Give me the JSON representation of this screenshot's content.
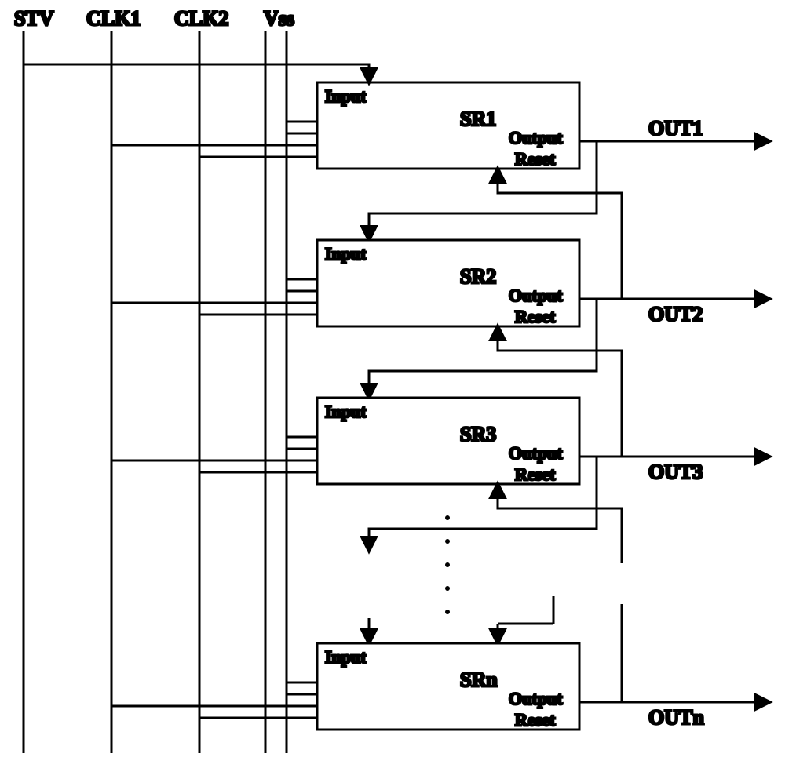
{
  "signals": {
    "stv": "STV",
    "clk1": "CLK1",
    "clk2": "CLK2",
    "vss": "Vss"
  },
  "port_labels": {
    "input": "Input",
    "output": "Output",
    "reset": "Reset"
  },
  "blocks": {
    "sr1": "SR1",
    "sr2": "SR2",
    "sr3": "SR3",
    "srn": "SRn"
  },
  "outputs": {
    "out1": "OUT1",
    "out2": "OUT2",
    "out3": "OUT3",
    "outn": "OUTn"
  }
}
